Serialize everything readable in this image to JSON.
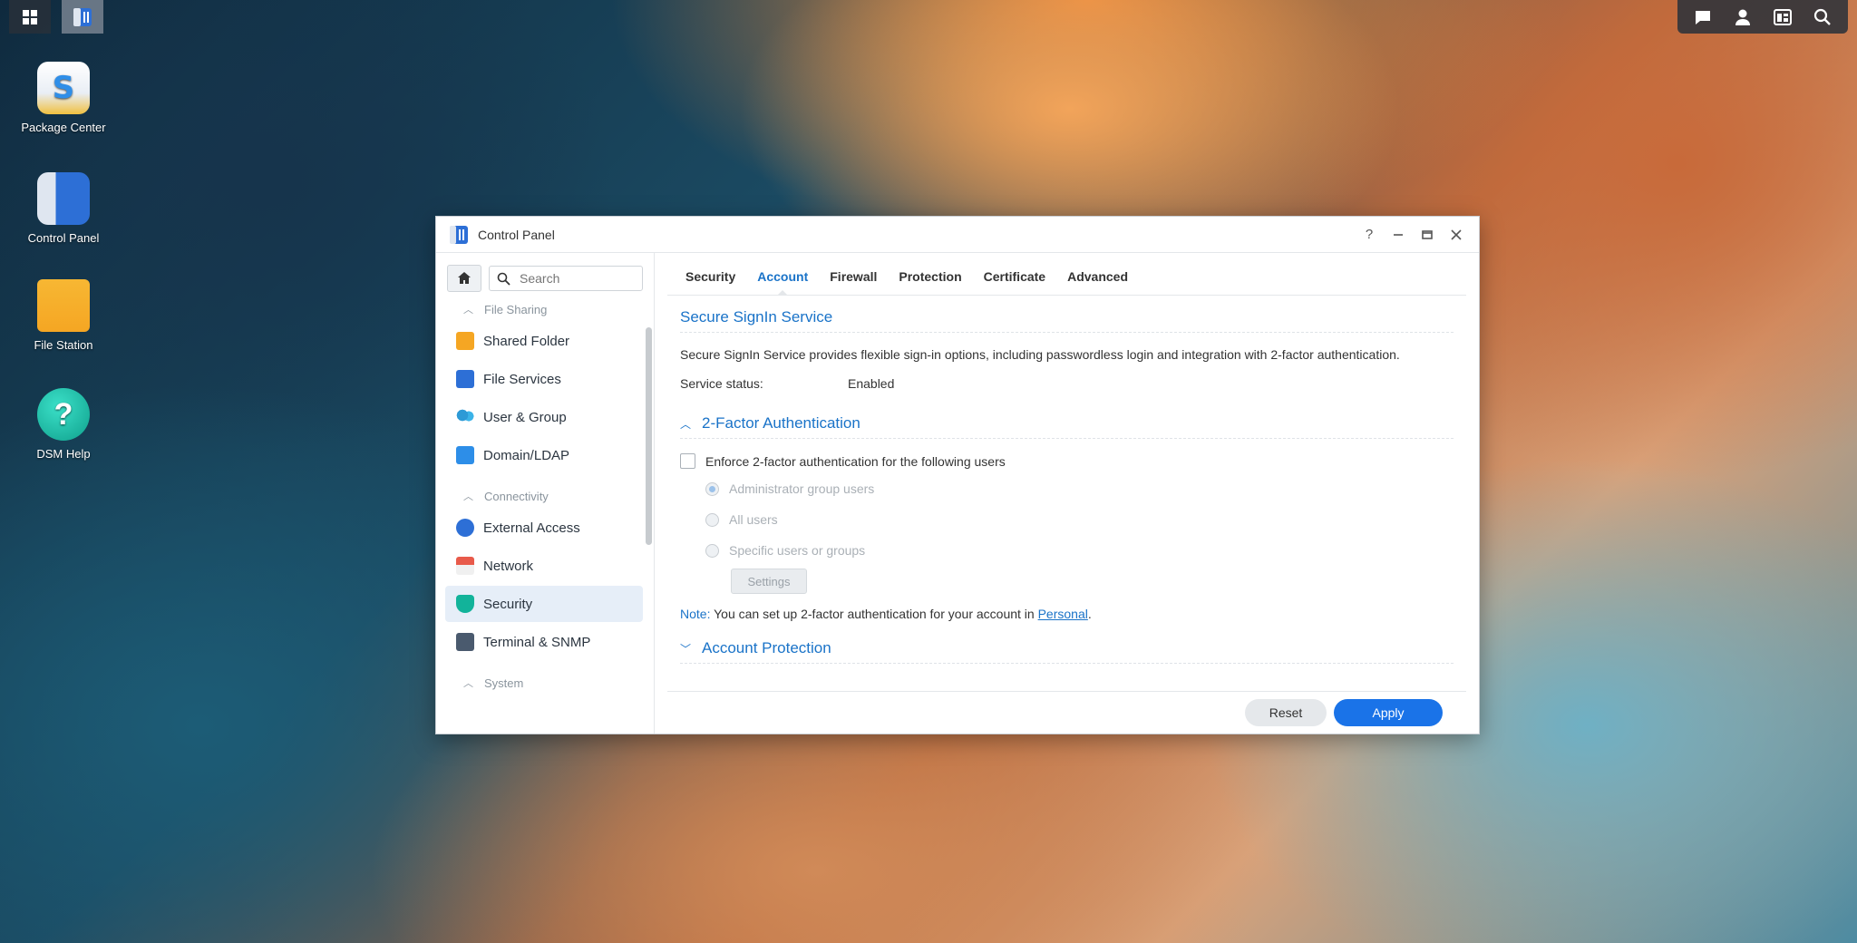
{
  "desktop": {
    "icons": [
      {
        "label": "Package Center"
      },
      {
        "label": "Control Panel"
      },
      {
        "label": "File Station"
      },
      {
        "label": "DSM Help"
      }
    ]
  },
  "window": {
    "title": "Control Panel",
    "search_placeholder": "Search",
    "sidebar": {
      "cat_file_sharing": "File Sharing",
      "shared_folder": "Shared Folder",
      "file_services": "File Services",
      "user_group": "User & Group",
      "domain_ldap": "Domain/LDAP",
      "cat_connectivity": "Connectivity",
      "external_access": "External Access",
      "network": "Network",
      "security": "Security",
      "terminal_snmp": "Terminal & SNMP",
      "cat_system": "System"
    },
    "tabs": [
      "Security",
      "Account",
      "Firewall",
      "Protection",
      "Certificate",
      "Advanced"
    ],
    "secure_signin": {
      "heading": "Secure SignIn Service",
      "description": "Secure SignIn Service provides flexible sign-in options, including passwordless login and integration with 2-factor authentication.",
      "status_label": "Service status:",
      "status_value": "Enabled"
    },
    "two_factor": {
      "heading": "2-Factor Authentication",
      "enforce_label": "Enforce 2-factor authentication for the following users",
      "opt_admin": "Administrator group users",
      "opt_all": "All users",
      "opt_specific": "Specific users or groups",
      "settings_btn": "Settings",
      "note_label": "Note:",
      "note_text": " You can set up 2-factor authentication for your account in ",
      "note_link": "Personal",
      "note_end": "."
    },
    "account_protection": {
      "heading": "Account Protection"
    },
    "footer": {
      "reset": "Reset",
      "apply": "Apply"
    }
  }
}
